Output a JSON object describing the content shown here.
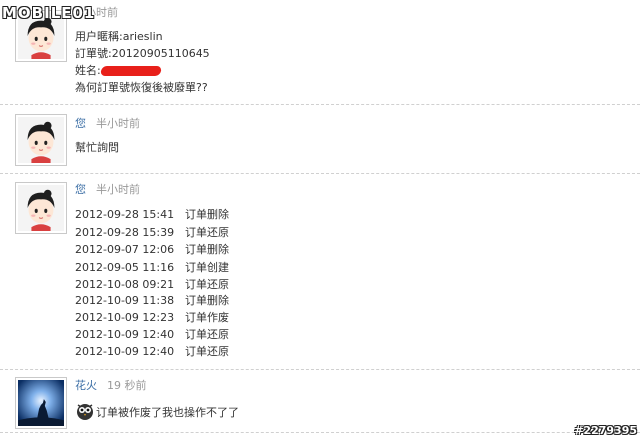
{
  "watermark": {
    "logo": "MOBILE01",
    "id": "#2279395"
  },
  "messages": [
    {
      "author": "",
      "time": "小时前",
      "lines": [
        "用户暱稱:arieslin",
        "訂單號:20120905110645",
        "姓名:",
        "為何訂單號恢復後被廢單??"
      ]
    },
    {
      "author": "您",
      "time": "半小时前",
      "lines": [
        "幫忙詢問"
      ]
    },
    {
      "author": "您",
      "time": "半小时前",
      "log": [
        {
          "datetime": "2012-09-28 15:41",
          "action": "订单删除"
        },
        {
          "datetime": "2012-09-28 15:39",
          "action": "订单还原"
        },
        {
          "datetime": "2012-09-07 12:06",
          "action": "订单删除"
        },
        {
          "datetime": "2012-09-05 11:16",
          "action": "订单创建"
        },
        {
          "datetime": "2012-10-08 09:21",
          "action": "订单还原"
        },
        {
          "datetime": "2012-10-09 11:38",
          "action": "订单删除"
        },
        {
          "datetime": "2012-10-09 12:23",
          "action": "订单作废"
        },
        {
          "datetime": "2012-10-09 12:40",
          "action": "订单还原"
        },
        {
          "datetime": "2012-10-09 12:40",
          "action": "订单还原"
        }
      ]
    },
    {
      "author": "花火",
      "time": "19 秒前",
      "lines": [
        "订单被作废了我也操作不了了"
      ]
    }
  ]
}
